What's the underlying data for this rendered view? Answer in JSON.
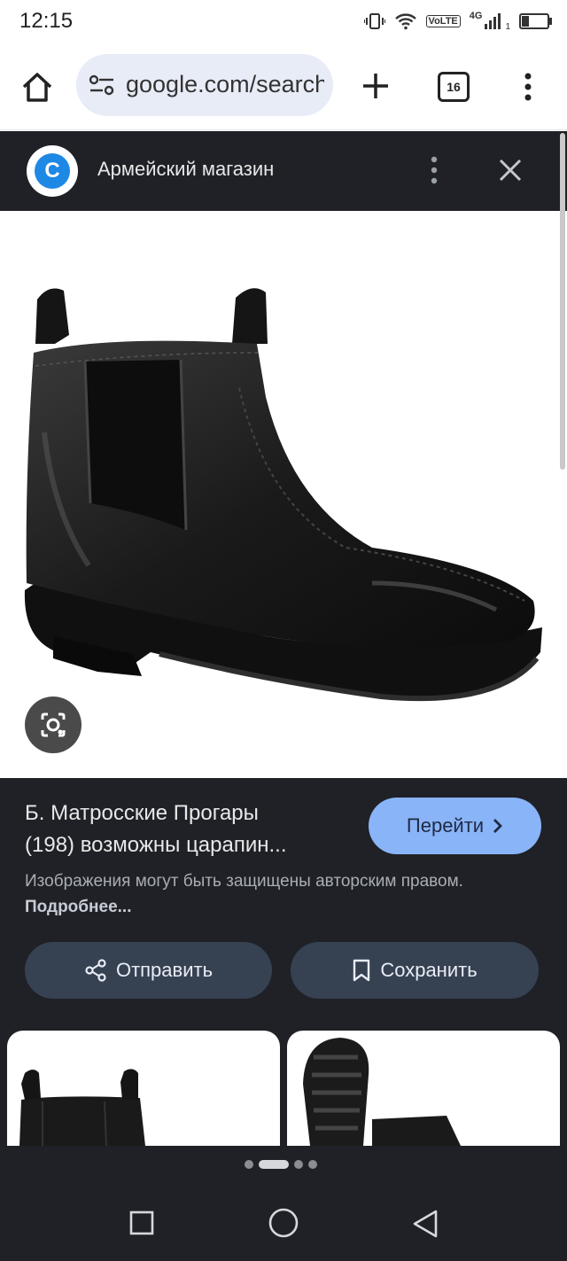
{
  "status_bar": {
    "time": "12:15",
    "network_label": "VoLTE",
    "network_gen": "4G",
    "sim_slot": "1"
  },
  "browser": {
    "url": "google.com/search",
    "tab_count": "16",
    "icons": [
      "home-icon",
      "site-settings-icon",
      "new-tab-icon",
      "tab-switcher-icon",
      "more-vert-icon"
    ]
  },
  "panel": {
    "site_logo_letter": "C",
    "site_name": "Армейский магазин",
    "icons": [
      "more-vert-icon",
      "close-icon"
    ]
  },
  "image": {
    "subject": "black leather chelsea boot",
    "lens_icon": "google-lens-icon"
  },
  "info": {
    "title_line1": "Б. Матросские Прогары",
    "title_line2": "(198) возможны царапин...",
    "visit_label": "Перейти",
    "copyright_text": "Изображения могут быть защищены авторским правом. ",
    "learn_more_label": "Подробнее...",
    "share_label": "Отправить",
    "save_label": "Сохранить"
  },
  "carousel": {
    "dots": 4,
    "active_index": 1
  },
  "nav_bar": {
    "icons": [
      "recent-apps-icon",
      "home-circle-icon",
      "back-triangle-icon"
    ]
  },
  "colors": {
    "panel_bg": "#1f2127",
    "accent": "#8ab4f8",
    "button_bg": "#364152",
    "url_bg": "#e8ecf7"
  }
}
